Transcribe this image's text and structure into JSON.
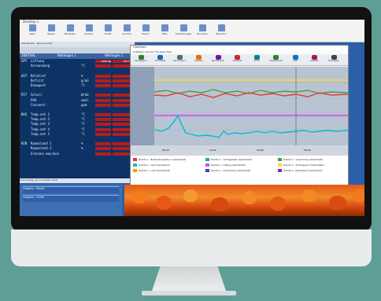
{
  "app": {
    "title": "Desktop 1"
  },
  "toolbar": {
    "items": [
      "Start",
      "Neues",
      "Einstellen",
      "Monitor",
      "Grafik",
      "Ansicht",
      "Export",
      "Hilfe",
      "Einstellungen",
      "Favoriten",
      "Beenden"
    ]
  },
  "left_panel": {
    "header": "Alle Kanäle - Neue Ansicht",
    "col_header_left": "ZENTRAL",
    "col_header_mid": "Wetlingen 1",
    "col_header_right": "Wetlingen 1",
    "rows": [
      {
        "group": "SPT",
        "label": "Lüftung",
        "unit": "",
        "v1": "seeing",
        "v2": "Soll"
      },
      {
        "group": "",
        "label": "Verwarmung",
        "unit": "°C",
        "v1": "",
        "v2": ""
      },
      {
        "group": "",
        "label": "",
        "unit": "",
        "v1": "",
        "v2": ""
      },
      {
        "group": "AST",
        "label": "Relatief",
        "unit": "%",
        "v1": "",
        "v2": ""
      },
      {
        "group": "",
        "label": "Deficit",
        "unit": "g/m3",
        "v1": "",
        "v2": ""
      },
      {
        "group": "",
        "label": "Dauwpunt",
        "unit": "°C",
        "v1": "",
        "v2": ""
      },
      {
        "group": "",
        "label": "",
        "unit": "",
        "v1": "",
        "v2": ""
      },
      {
        "group": "PIT",
        "label": "Solari",
        "unit": "W/m2",
        "v1": "",
        "v2": ""
      },
      {
        "group": "",
        "label": "PAR",
        "unit": "umol",
        "v1": "",
        "v2": ""
      },
      {
        "group": "",
        "label": "Concentr.",
        "unit": "ppm",
        "v1": "",
        "v2": ""
      },
      {
        "group": "",
        "label": "",
        "unit": "",
        "v1": "",
        "v2": ""
      },
      {
        "group": "BUS",
        "label": "Temp.net 1",
        "unit": "°C",
        "v1": "",
        "v2": ""
      },
      {
        "group": "",
        "label": "Temp.net 2",
        "unit": "°C",
        "v1": "",
        "v2": ""
      },
      {
        "group": "",
        "label": "Temp.net 3",
        "unit": "°C",
        "v1": "",
        "v2": ""
      },
      {
        "group": "",
        "label": "Temp.net 4",
        "unit": "°C",
        "v1": "",
        "v2": ""
      },
      {
        "group": "",
        "label": "Temp.net 5",
        "unit": "°C",
        "v1": "",
        "v2": ""
      },
      {
        "group": "",
        "label": "",
        "unit": "",
        "v1": "",
        "v2": ""
      },
      {
        "group": "RIN",
        "label": "Raamstand 1",
        "unit": "%",
        "v1": "",
        "v2": ""
      },
      {
        "group": "",
        "label": "Raamstand 2",
        "unit": "%",
        "v1": "",
        "v2": ""
      },
      {
        "group": "",
        "label": "Grenzen max/min",
        "unit": "",
        "v1": "",
        "v2": ""
      }
    ],
    "status": "Donnerstag, 20 november 2018"
  },
  "bottom_left": {
    "items": [
      "Lexigens - Kassel",
      "Lexigens - Lichte"
    ]
  },
  "chart_window": {
    "title": "Grafieken",
    "menu": "Grafieken  Venster  Tijd  Data  Help",
    "buttons": [
      "Startpagina",
      "Informatie",
      "Alle Sensors",
      "Opslaan",
      "Nieuwe graf.",
      "Verwijder",
      "Scroll",
      "Meetwaarde",
      "Lijst",
      "Instellen",
      "Toevoegen"
    ],
    "time_labels": [
      "06:00",
      "12:00",
      "18:00",
      "00:00"
    ],
    "legend": [
      {
        "label": "Ruimte 1 - Buitentemperatuur (Gemiddeld)",
        "color": "#e53935"
      },
      {
        "label": "Ruimte 1 - Vochtgehalte (Gemiddeld)",
        "color": "#26a69a"
      },
      {
        "label": "Ruimte 1 - Verwarming (Gemiddeld)",
        "color": "#43a047"
      },
      {
        "label": "Ruimte 1 - CO2 (Gemiddeld)",
        "color": "#00bcd4"
      },
      {
        "label": "Ruimte 1 - Lüftung (Gemiddeld)",
        "color": "#e040fb"
      },
      {
        "label": "Ruimte 1 - Stralingssom (Gemiddeld)",
        "color": "#fdd835"
      },
      {
        "label": "Ruimte 1 - Licht (Gemiddeld)",
        "color": "#ff9800"
      },
      {
        "label": "Ruimte 1 - Verwarming (Gemiddeld)",
        "color": "#3949ab"
      },
      {
        "label": "Ruimte 1 - Raamstand (Gemiddeld)",
        "color": "#8e24aa"
      }
    ]
  }
}
